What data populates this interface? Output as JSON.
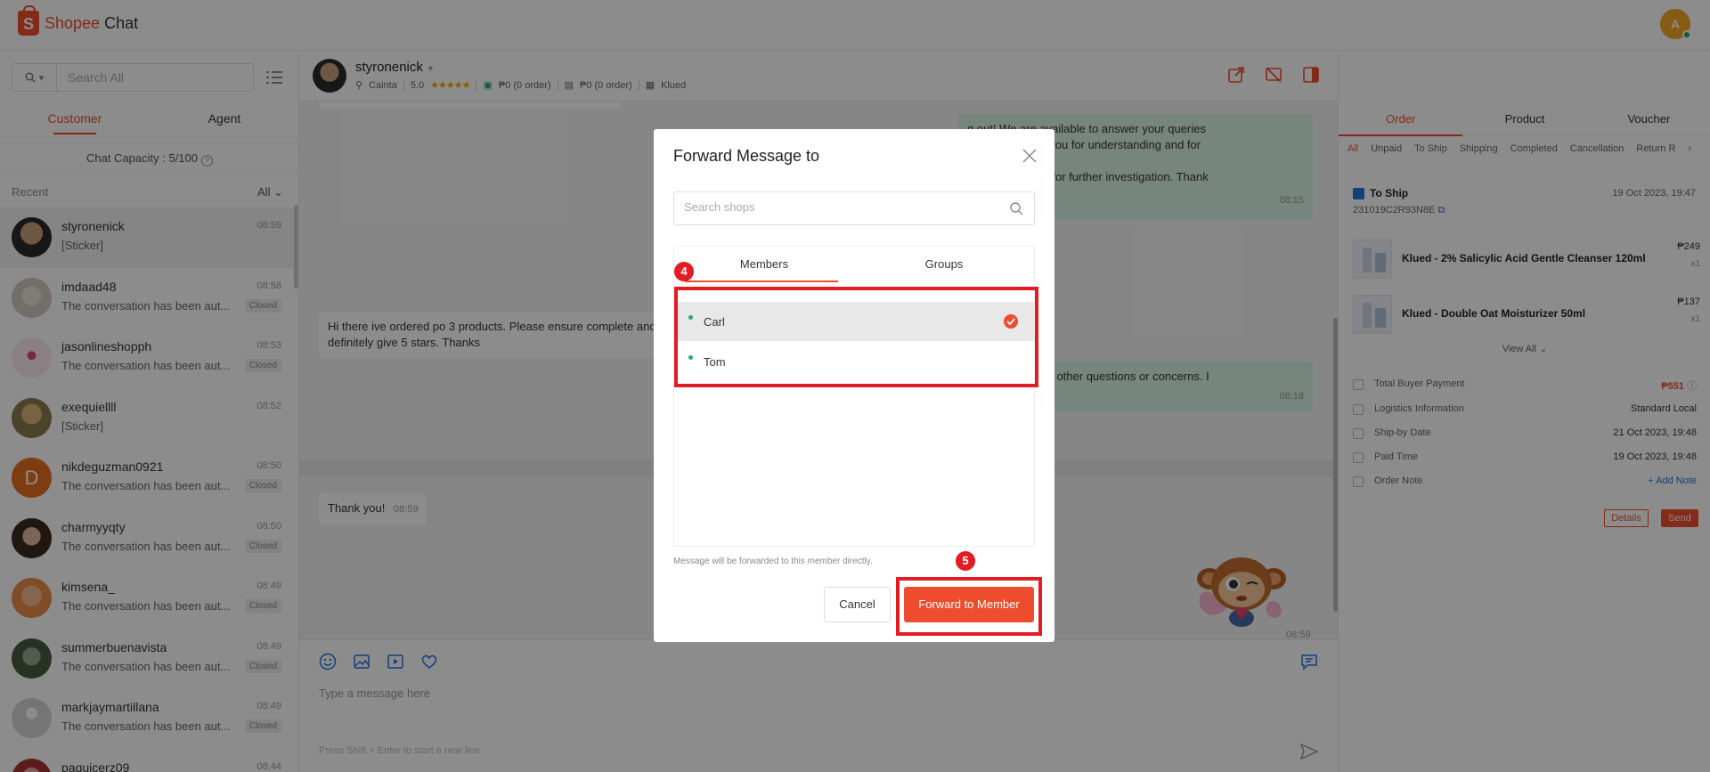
{
  "app": {
    "brand": "Shopee",
    "title": "Chat",
    "user_initial": "A"
  },
  "sidebar": {
    "search_placeholder": "Search All",
    "tabs": [
      "Customer",
      "Agent"
    ],
    "capacity": "Chat Capacity : 5/100",
    "recent_label": "Recent",
    "filter": "All",
    "chats": [
      {
        "name": "styronenick",
        "time": "08:59",
        "message": "[Sticker]",
        "badge": ""
      },
      {
        "name": "imdaad48",
        "time": "08:58",
        "message": "The conversation has been aut...",
        "badge": "Closed"
      },
      {
        "name": "jasonlineshopph",
        "time": "08:53",
        "message": "The conversation has been aut...",
        "badge": "Closed"
      },
      {
        "name": "exequiellll",
        "time": "08:52",
        "message": "[Sticker]",
        "badge": ""
      },
      {
        "name": "nikdeguzman0921",
        "time": "08:50",
        "message": "The conversation has been aut...",
        "badge": "Closed"
      },
      {
        "name": "charmyyqty",
        "time": "08:50",
        "message": "The conversation has been aut...",
        "badge": "Closed"
      },
      {
        "name": "kimsena_",
        "time": "08:49",
        "message": "The conversation has been aut...",
        "badge": "Closed"
      },
      {
        "name": "summerbuenavista",
        "time": "08:49",
        "message": "The conversation has been aut...",
        "badge": "Closed"
      },
      {
        "name": "markjaymartillana",
        "time": "08:49",
        "message": "The conversation has been aut...",
        "badge": "Closed"
      },
      {
        "name": "paquicerz09",
        "time": "08:44",
        "message": "",
        "badge": ""
      }
    ],
    "avatar_letter_d": "D"
  },
  "chat": {
    "name": "styronenick",
    "location": "Cainta",
    "rating": "5.0",
    "stars": "★★★★★",
    "paid": "₱0 (0 order)",
    "unpaid": "₱0 (0 order)",
    "shop": "Klued",
    "messages": {
      "r1_line1": "g out! We are available to answer your queries",
      "r1_line2": "soonest! Thank you for understanding and for",
      "r1_line3": "E OF WAY BILL for further investigation. Thank",
      "r1_time": "08:15",
      "l1_line1": "Hi there ive ordered po 3 products. Please ensure complete and",
      "l1_line2": "definitely give 5 stars. Thanks",
      "r2_line1": "know if you have other questions or concerns. I",
      "r2_time": "08:18",
      "l2_text": "Thank you!",
      "l2_time": "08:59",
      "sticker_time": "08:59"
    },
    "input_placeholder": "Type a message here",
    "input_hint": "Press Shift + Enter to start a new line"
  },
  "order_panel": {
    "tabs": [
      "Order",
      "Product",
      "Voucher"
    ],
    "filters": [
      "All",
      "Unpaid",
      "To Ship",
      "Shipping",
      "Completed",
      "Cancellation",
      "Return R"
    ],
    "status": "To Ship",
    "date": "19 Oct 2023, 19:47",
    "order_id": "231019C2R93N8E",
    "products": [
      {
        "name": "Klued - 2% Salicylic Acid Gentle Cleanser 120ml",
        "price": "₱249",
        "qty": "x1"
      },
      {
        "name": "Klued - Double Oat Moisturizer 50ml",
        "price": "₱137",
        "qty": "x1"
      }
    ],
    "view_all": "View All",
    "info": [
      {
        "key": "Total Buyer Payment",
        "value": "₱551"
      },
      {
        "key": "Logistics Information",
        "value": "Standard Local"
      },
      {
        "key": "Ship-by Date",
        "value": "21 Oct 2023, 19:48"
      },
      {
        "key": "Paid Time",
        "value": "19 Oct 2023, 19:48"
      },
      {
        "key": "Order Note",
        "value": "+ Add Note"
      }
    ],
    "details_label": "Details",
    "send_label": "Send"
  },
  "modal": {
    "title": "Forward Message to",
    "search_placeholder": "Search shops",
    "tabs": [
      "Members",
      "Groups"
    ],
    "members": [
      "Carl",
      "Tom"
    ],
    "note": "Message will be forwarded to this member directly.",
    "cancel_label": "Cancel",
    "forward_label": "Forward to Member"
  },
  "annotations": {
    "step4": "4",
    "step5": "5"
  },
  "colors": {
    "brand": "#ee4d2d",
    "highlight": "#e31b23",
    "online": "#26aa6a"
  }
}
